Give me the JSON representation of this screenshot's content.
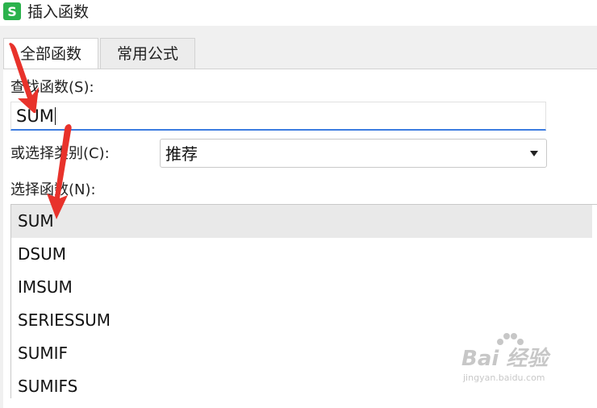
{
  "window": {
    "title": "插入函数",
    "app_icon_letter": "S"
  },
  "tabs": [
    {
      "label": "全部函数",
      "active": true
    },
    {
      "label": "常用公式",
      "active": false
    }
  ],
  "search": {
    "label": "查找函数(S):",
    "value": "SUM"
  },
  "category": {
    "label": "或选择类别(C):",
    "value": "推荐"
  },
  "function_list": {
    "label": "选择函数(N):",
    "items": [
      "SUM",
      "DSUM",
      "IMSUM",
      "SERIESSUM",
      "SUMIF",
      "SUMIFS"
    ],
    "selected": "SUM"
  },
  "watermark": {
    "main": "Bai 经验",
    "sub": "jingyan.baidu.com"
  },
  "colors": {
    "accent": "#3d7de0",
    "app_icon": "#2bb24c",
    "annotation_arrow": "#e8322b"
  }
}
